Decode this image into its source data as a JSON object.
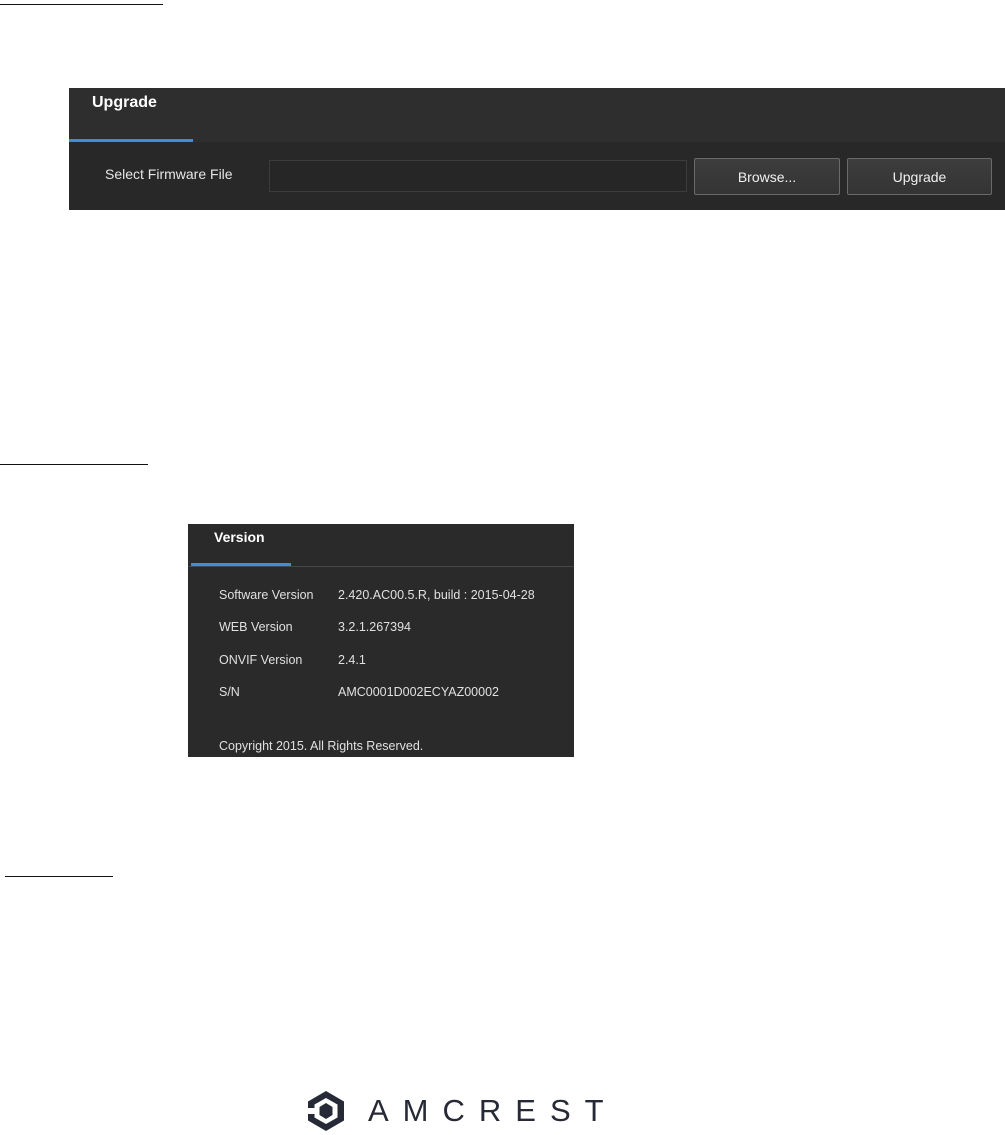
{
  "upgrade_panel": {
    "tab_label": "Upgrade",
    "file_label": "Select Firmware File",
    "file_value": "",
    "browse_label": "Browse...",
    "upgrade_label": "Upgrade"
  },
  "version_panel": {
    "tab_label": "Version",
    "rows": [
      {
        "label": "Software Version",
        "value": "2.420.AC00.5.R, build : 2015-04-28"
      },
      {
        "label": "WEB Version",
        "value": "3.2.1.267394"
      },
      {
        "label": "ONVIF Version",
        "value": "2.4.1"
      },
      {
        "label": "S/N",
        "value": "AMC0001D002ECYAZ00002"
      }
    ],
    "copyright": "Copyright 2015. All Rights Reserved."
  },
  "logo": {
    "icon": "amcrest-shield-logo-icon",
    "text": "AMCREST"
  },
  "colors": {
    "panel_background": "#2b2b2b",
    "tab_accent": "#3f8ed6",
    "logo_text": "#262a36"
  }
}
